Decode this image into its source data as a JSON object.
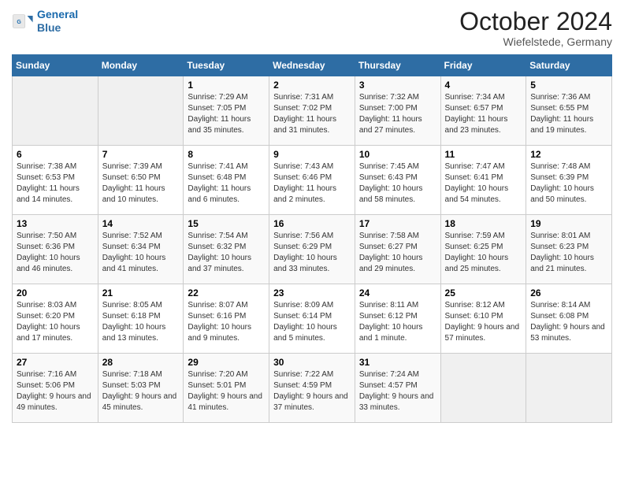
{
  "header": {
    "logo_line1": "General",
    "logo_line2": "Blue",
    "month": "October 2024",
    "location": "Wiefelstede, Germany"
  },
  "weekdays": [
    "Sunday",
    "Monday",
    "Tuesday",
    "Wednesday",
    "Thursday",
    "Friday",
    "Saturday"
  ],
  "weeks": [
    [
      {
        "day": "",
        "info": ""
      },
      {
        "day": "",
        "info": ""
      },
      {
        "day": "1",
        "info": "Sunrise: 7:29 AM\nSunset: 7:05 PM\nDaylight: 11 hours and 35 minutes."
      },
      {
        "day": "2",
        "info": "Sunrise: 7:31 AM\nSunset: 7:02 PM\nDaylight: 11 hours and 31 minutes."
      },
      {
        "day": "3",
        "info": "Sunrise: 7:32 AM\nSunset: 7:00 PM\nDaylight: 11 hours and 27 minutes."
      },
      {
        "day": "4",
        "info": "Sunrise: 7:34 AM\nSunset: 6:57 PM\nDaylight: 11 hours and 23 minutes."
      },
      {
        "day": "5",
        "info": "Sunrise: 7:36 AM\nSunset: 6:55 PM\nDaylight: 11 hours and 19 minutes."
      }
    ],
    [
      {
        "day": "6",
        "info": "Sunrise: 7:38 AM\nSunset: 6:53 PM\nDaylight: 11 hours and 14 minutes."
      },
      {
        "day": "7",
        "info": "Sunrise: 7:39 AM\nSunset: 6:50 PM\nDaylight: 11 hours and 10 minutes."
      },
      {
        "day": "8",
        "info": "Sunrise: 7:41 AM\nSunset: 6:48 PM\nDaylight: 11 hours and 6 minutes."
      },
      {
        "day": "9",
        "info": "Sunrise: 7:43 AM\nSunset: 6:46 PM\nDaylight: 11 hours and 2 minutes."
      },
      {
        "day": "10",
        "info": "Sunrise: 7:45 AM\nSunset: 6:43 PM\nDaylight: 10 hours and 58 minutes."
      },
      {
        "day": "11",
        "info": "Sunrise: 7:47 AM\nSunset: 6:41 PM\nDaylight: 10 hours and 54 minutes."
      },
      {
        "day": "12",
        "info": "Sunrise: 7:48 AM\nSunset: 6:39 PM\nDaylight: 10 hours and 50 minutes."
      }
    ],
    [
      {
        "day": "13",
        "info": "Sunrise: 7:50 AM\nSunset: 6:36 PM\nDaylight: 10 hours and 46 minutes."
      },
      {
        "day": "14",
        "info": "Sunrise: 7:52 AM\nSunset: 6:34 PM\nDaylight: 10 hours and 41 minutes."
      },
      {
        "day": "15",
        "info": "Sunrise: 7:54 AM\nSunset: 6:32 PM\nDaylight: 10 hours and 37 minutes."
      },
      {
        "day": "16",
        "info": "Sunrise: 7:56 AM\nSunset: 6:29 PM\nDaylight: 10 hours and 33 minutes."
      },
      {
        "day": "17",
        "info": "Sunrise: 7:58 AM\nSunset: 6:27 PM\nDaylight: 10 hours and 29 minutes."
      },
      {
        "day": "18",
        "info": "Sunrise: 7:59 AM\nSunset: 6:25 PM\nDaylight: 10 hours and 25 minutes."
      },
      {
        "day": "19",
        "info": "Sunrise: 8:01 AM\nSunset: 6:23 PM\nDaylight: 10 hours and 21 minutes."
      }
    ],
    [
      {
        "day": "20",
        "info": "Sunrise: 8:03 AM\nSunset: 6:20 PM\nDaylight: 10 hours and 17 minutes."
      },
      {
        "day": "21",
        "info": "Sunrise: 8:05 AM\nSunset: 6:18 PM\nDaylight: 10 hours and 13 minutes."
      },
      {
        "day": "22",
        "info": "Sunrise: 8:07 AM\nSunset: 6:16 PM\nDaylight: 10 hours and 9 minutes."
      },
      {
        "day": "23",
        "info": "Sunrise: 8:09 AM\nSunset: 6:14 PM\nDaylight: 10 hours and 5 minutes."
      },
      {
        "day": "24",
        "info": "Sunrise: 8:11 AM\nSunset: 6:12 PM\nDaylight: 10 hours and 1 minute."
      },
      {
        "day": "25",
        "info": "Sunrise: 8:12 AM\nSunset: 6:10 PM\nDaylight: 9 hours and 57 minutes."
      },
      {
        "day": "26",
        "info": "Sunrise: 8:14 AM\nSunset: 6:08 PM\nDaylight: 9 hours and 53 minutes."
      }
    ],
    [
      {
        "day": "27",
        "info": "Sunrise: 7:16 AM\nSunset: 5:06 PM\nDaylight: 9 hours and 49 minutes."
      },
      {
        "day": "28",
        "info": "Sunrise: 7:18 AM\nSunset: 5:03 PM\nDaylight: 9 hours and 45 minutes."
      },
      {
        "day": "29",
        "info": "Sunrise: 7:20 AM\nSunset: 5:01 PM\nDaylight: 9 hours and 41 minutes."
      },
      {
        "day": "30",
        "info": "Sunrise: 7:22 AM\nSunset: 4:59 PM\nDaylight: 9 hours and 37 minutes."
      },
      {
        "day": "31",
        "info": "Sunrise: 7:24 AM\nSunset: 4:57 PM\nDaylight: 9 hours and 33 minutes."
      },
      {
        "day": "",
        "info": ""
      },
      {
        "day": "",
        "info": ""
      }
    ]
  ]
}
